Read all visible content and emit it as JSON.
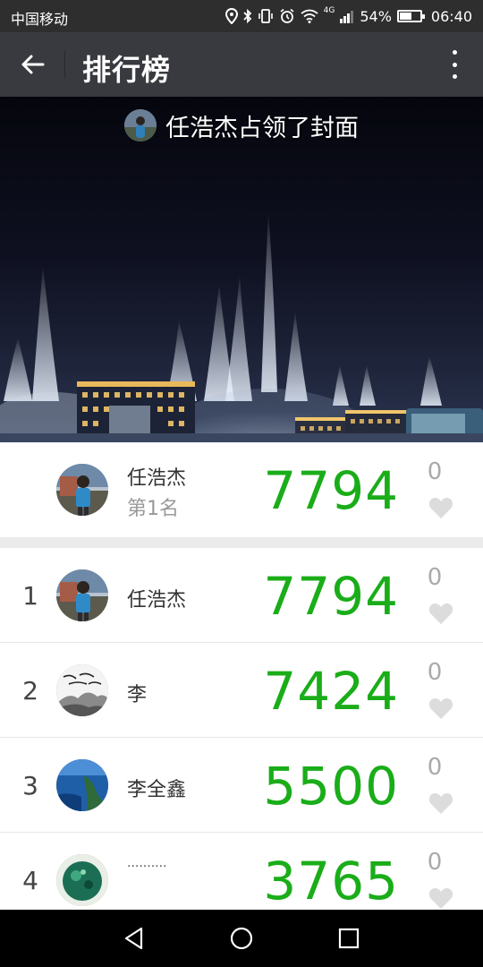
{
  "status_bar": {
    "carrier": "中国移动",
    "network": "4G",
    "battery_percent": "54%",
    "battery_level": 0.54,
    "time": "06:40"
  },
  "header": {
    "title": "排行榜",
    "back_icon": "arrow-left-icon",
    "more_icon": "more-vertical-icon"
  },
  "cover": {
    "text": "任浩杰占领了封面"
  },
  "my_rank": {
    "name": "任浩杰",
    "rank_text": "第1名",
    "steps": "7794",
    "likes": "0"
  },
  "rank_list": [
    {
      "rank": "1",
      "name": "任浩杰",
      "steps": "7794",
      "likes": "0"
    },
    {
      "rank": "2",
      "name": "李",
      "steps": "7424",
      "likes": "0"
    },
    {
      "rank": "3",
      "name": "李全鑫",
      "steps": "5500",
      "likes": "0"
    },
    {
      "rank": "4",
      "name": "··········",
      "steps": "3765",
      "likes": "0"
    }
  ],
  "colors": {
    "steps_green": "#1aad19",
    "title_bar": "#393a3f",
    "status_bar": "#2e2e2e"
  },
  "nav": {
    "back_icon": "triangle-back-icon",
    "home_icon": "circle-home-icon",
    "recents_icon": "square-recents-icon"
  }
}
